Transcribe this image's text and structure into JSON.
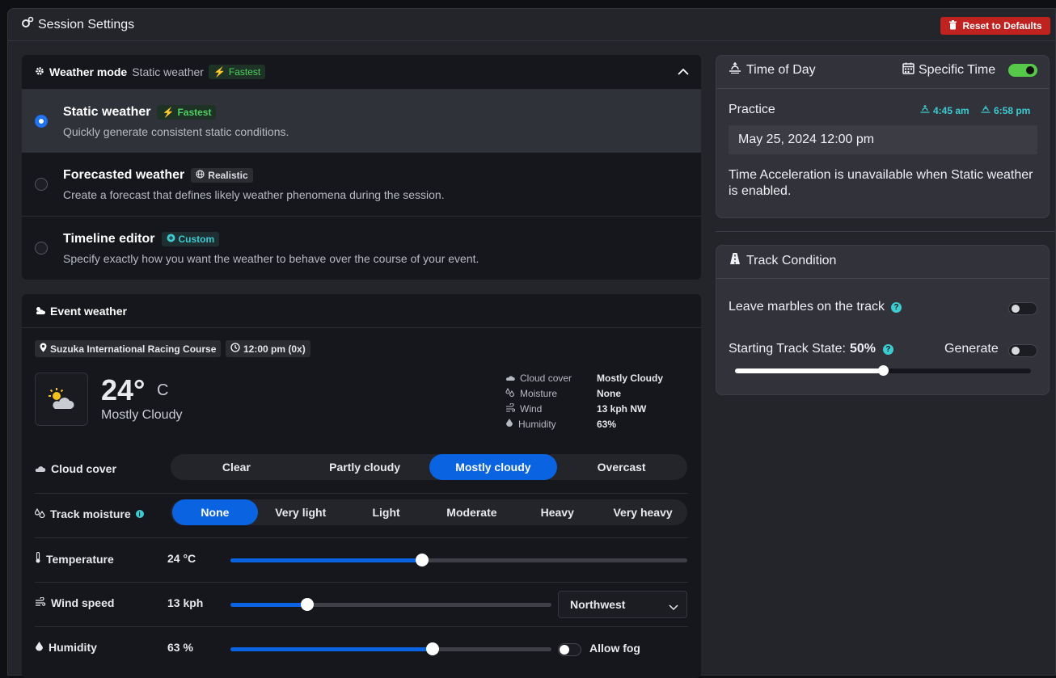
{
  "header": {
    "title": "Session Settings",
    "reset_label": "Reset to Defaults"
  },
  "weather_mode": {
    "label": "Weather mode",
    "current": "Static weather",
    "current_tag": "Fastest",
    "options": [
      {
        "title": "Static weather",
        "tag": "Fastest",
        "desc": "Quickly generate consistent static conditions.",
        "selected": true
      },
      {
        "title": "Forecasted weather",
        "tag": "Realistic",
        "desc": "Create a forecast that defines likely weather phenomena during the session.",
        "selected": false
      },
      {
        "title": "Timeline editor",
        "tag": "Custom",
        "desc": "Specify exactly how you want the weather to behave over the course of your event.",
        "selected": false
      }
    ]
  },
  "event_weather": {
    "label": "Event weather",
    "track": "Suzuka International Racing Course",
    "time": "12:00 pm (0x)",
    "temp": "24°",
    "unit": "C",
    "condition": "Mostly Cloudy",
    "stats": [
      {
        "key": "Cloud cover",
        "value": "Mostly Cloudy",
        "icon": "cloud-icon"
      },
      {
        "key": "Moisture",
        "value": "None",
        "icon": "droplets-icon"
      },
      {
        "key": "Wind",
        "value": "13 kph NW",
        "icon": "wind-icon"
      },
      {
        "key": "Humidity",
        "value": "63%",
        "icon": "humidity-icon"
      }
    ],
    "cloud_cover": {
      "label": "Cloud cover",
      "options": [
        "Clear",
        "Partly cloudy",
        "Mostly cloudy",
        "Overcast"
      ],
      "selected": "Mostly cloudy"
    },
    "track_moisture": {
      "label": "Track moisture",
      "options": [
        "None",
        "Very light",
        "Light",
        "Moderate",
        "Heavy",
        "Very heavy"
      ],
      "selected": "None"
    },
    "temperature": {
      "label": "Temperature",
      "value": "24 °C",
      "level": 0.42
    },
    "wind_speed": {
      "label": "Wind speed",
      "value": "13 kph",
      "level": 0.24,
      "direction": "Northwest"
    },
    "humidity": {
      "label": "Humidity",
      "value": "63 %",
      "level": 0.63,
      "fog_label": "Allow fog",
      "fog": false
    }
  },
  "time_of_day": {
    "label": "Time of Day",
    "specific_label": "Specific Time",
    "specific": true,
    "session": "Practice",
    "sunrise": "4:45 am",
    "sunset": "6:58 pm",
    "datetime": "May 25, 2024 12:00 pm",
    "note": "Time Acceleration is unavailable when Static weather is enabled."
  },
  "track_condition": {
    "label": "Track Condition",
    "marbles_label": "Leave marbles on the track",
    "marbles": false,
    "state_label": "Starting Track State:",
    "state_value": "50%",
    "state_level": 0.5,
    "generate_label": "Generate",
    "generate": false
  },
  "colors": {
    "accent": "#0a63e0",
    "danger": "#c0221f",
    "success": "#56c84a",
    "teal": "#3ccbd0",
    "green_tag": "#4fd063"
  }
}
